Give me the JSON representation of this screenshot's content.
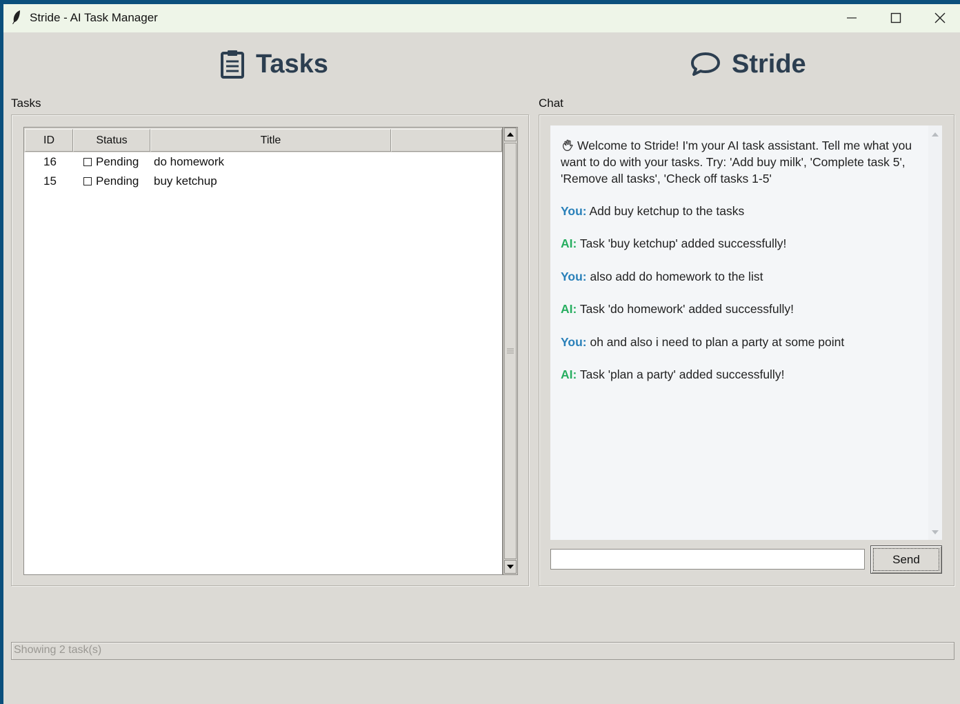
{
  "window": {
    "title": "Stride - AI Task Manager",
    "app_icon": "feather-icon",
    "controls": [
      "minimize-icon",
      "maximize-icon",
      "close-icon"
    ]
  },
  "tasks_panel": {
    "heading": "Tasks",
    "heading_icon": "clipboard-icon",
    "frame_label": "Tasks",
    "columns": [
      "ID",
      "Status",
      "Title",
      ""
    ],
    "rows": [
      {
        "id": "16",
        "status": "Pending",
        "title": "do homework"
      },
      {
        "id": "15",
        "status": "Pending",
        "title": "buy ketchup"
      }
    ]
  },
  "chat_panel": {
    "heading": "Stride",
    "heading_icon": "speech-bubble-icon",
    "frame_label": "Chat",
    "welcome_icon": "waving-hand-icon",
    "welcome": "Welcome to Stride! I'm your AI task assistant. Tell me what you want to do with your tasks. Try: 'Add buy milk', 'Complete task 5', 'Remove all tasks', 'Check off tasks 1-5'",
    "messages": [
      {
        "speaker": "You:",
        "text": "Add buy ketchup to the tasks"
      },
      {
        "speaker": "AI:",
        "text": "Task 'buy ketchup' added successfully!"
      },
      {
        "speaker": "You:",
        "text": "also add do homework to the list"
      },
      {
        "speaker": "AI:",
        "text": "Task 'do homework' added successfully!"
      },
      {
        "speaker": "You:",
        "text": "oh and also i need to plan a party at some point"
      },
      {
        "speaker": "AI:",
        "text": "Task 'plan a party' added successfully!"
      }
    ],
    "input_value": "",
    "send_label": "Send"
  },
  "status": "Showing 2 task(s)",
  "colors": {
    "heading": "#2c3e50",
    "you": "#2980b9",
    "ai": "#27ae60",
    "background": "#dcdad5"
  }
}
